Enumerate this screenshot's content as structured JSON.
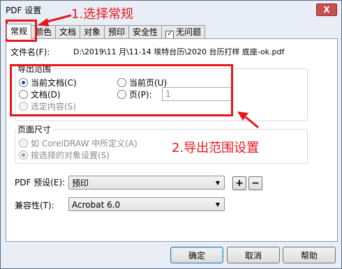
{
  "window": {
    "title": "PDF 设置",
    "close_glyph": "X"
  },
  "tabs": [
    {
      "label": "常规"
    },
    {
      "label": "颜色"
    },
    {
      "label": "文档"
    },
    {
      "label": "对象"
    },
    {
      "label": "预印"
    },
    {
      "label": "安全性"
    },
    {
      "label": "无问题",
      "checkbox": true
    }
  ],
  "filename": {
    "label": "文件名(F):",
    "value": "D:\\2019\\11 月\\11-14 埃特台历\\2020 台历打样 底座-ok.pdf"
  },
  "export_range": {
    "title": "导出范围",
    "options": [
      {
        "label": "当前文档(C)",
        "selected": true,
        "disabled": false
      },
      {
        "label": "当前页(U)",
        "selected": false,
        "disabled": false
      },
      {
        "label": "文档(D)",
        "selected": false,
        "disabled": false
      },
      {
        "label": "页(P):",
        "selected": false,
        "disabled": false
      },
      {
        "label": "选定内容(S)",
        "selected": false,
        "disabled": true
      }
    ],
    "page_value": "1"
  },
  "page_size": {
    "title": "页面尺寸",
    "options": [
      {
        "label": "如 CorelDRAW 中所定义(A)",
        "selected": false
      },
      {
        "label": "按选择的对象设置(S)",
        "selected": true
      }
    ]
  },
  "pdf_preset": {
    "label": "PDF 预设(E):",
    "value": "预印",
    "add_glyph": "+",
    "remove_glyph": "−"
  },
  "compatibility": {
    "label": "兼容性(T):",
    "value": "Acrobat 6.0"
  },
  "buttons": {
    "ok": "确定",
    "cancel": "取消",
    "help": "帮助"
  },
  "annotations": {
    "step1": "1.选择常规",
    "step2": "2.导出范围设置"
  },
  "colors": {
    "annotation_red": "#e8151b",
    "dialog_bg": "#e9eef6"
  }
}
